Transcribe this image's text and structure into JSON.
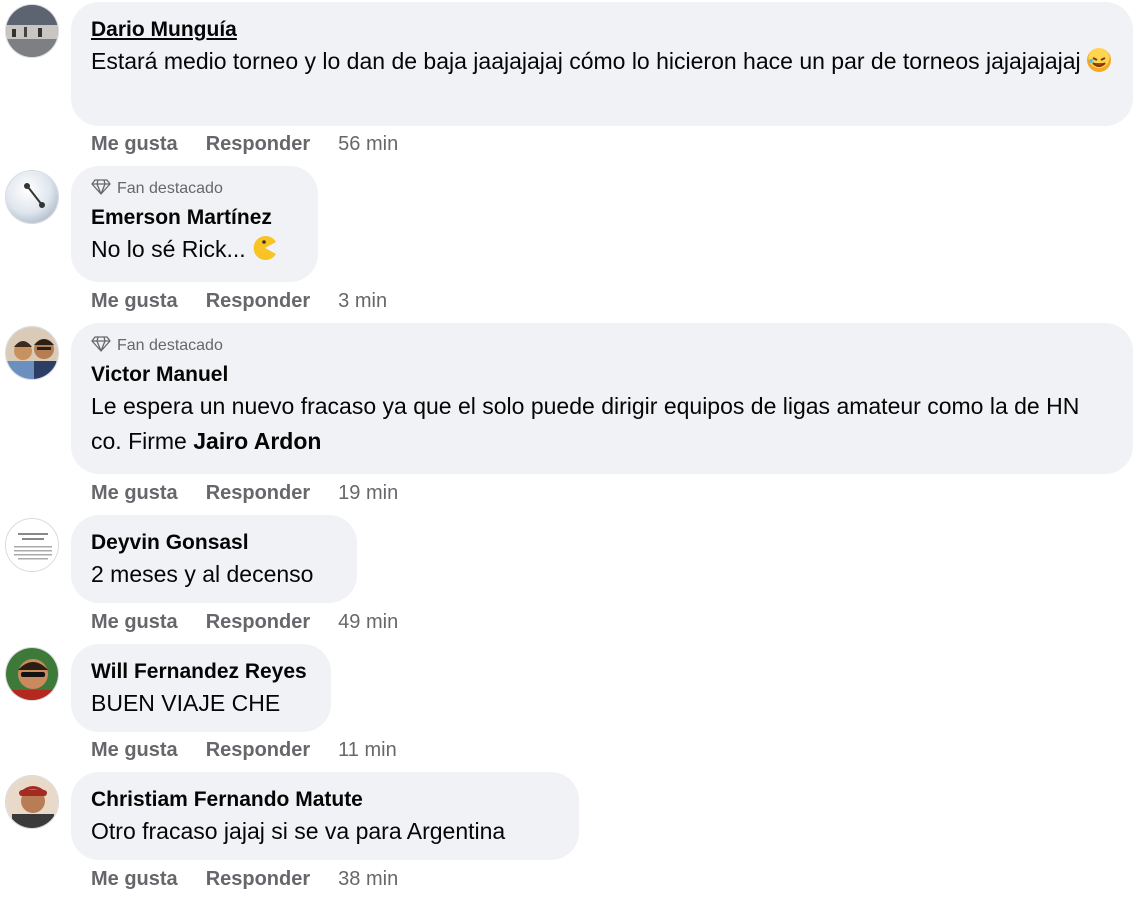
{
  "action_labels": {
    "like": "Me gusta",
    "reply": "Responder"
  },
  "comments": [
    {
      "author": "Dario Munguía",
      "text": "Estará medio torneo y lo dan de baja jaajajajaj cómo lo hicieron hace un par de torneos jajajajajaj",
      "emoji": "rolling-on-floor-laughing-emoji",
      "time": "56 min"
    },
    {
      "badge": "Fan destacado",
      "author": "Emerson Martínez",
      "text": "No lo sé Rick...",
      "emoji": "pacman-emoji",
      "time": "3 min"
    },
    {
      "badge": "Fan destacado",
      "author": "Victor Manuel",
      "text": "Le espera un nuevo fracaso ya que el solo puede dirigir equipos de ligas amateur como la de HN co. Firme",
      "mention": "Jairo Ardon",
      "time": "19 min"
    },
    {
      "author": "Deyvin Gonsasl",
      "text": "2 meses y al decenso",
      "time": "49 min"
    },
    {
      "author": "Will Fernandez Reyes",
      "text": "BUEN VIAJE CHE",
      "time": "11 min"
    },
    {
      "author": "Christiam Fernando Matute",
      "text": "Otro fracaso jajaj si se va para Argentina",
      "time": "38 min"
    }
  ]
}
